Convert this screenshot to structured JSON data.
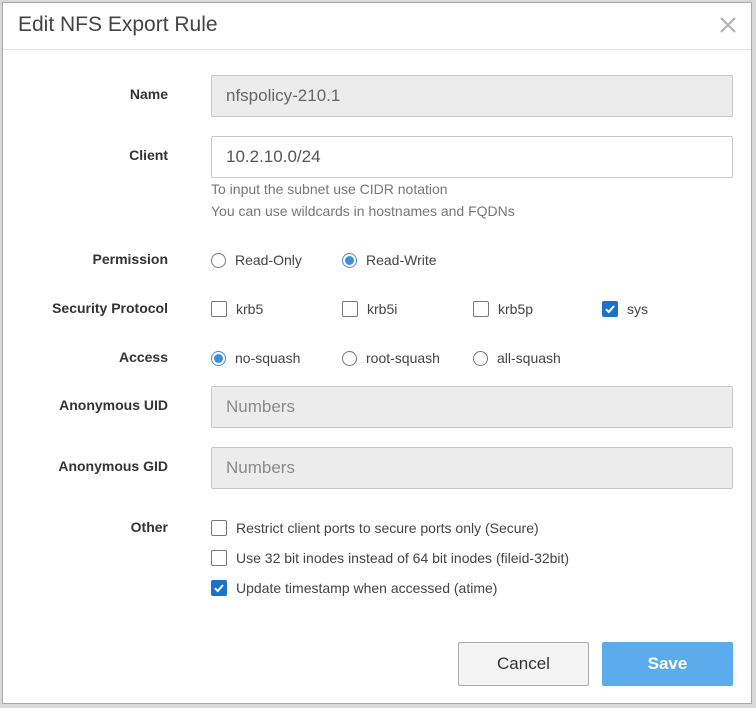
{
  "dialog": {
    "title": "Edit NFS Export Rule",
    "close_icon": "close-icon"
  },
  "fields": {
    "name": {
      "label": "Name",
      "value": "nfspolicy-210.1"
    },
    "client": {
      "label": "Client",
      "value": "10.2.10.0/24",
      "hint1": "To input the subnet use CIDR notation",
      "hint2": "You can use wildcards in hostnames and FQDNs"
    },
    "anon_uid": {
      "label": "Anonymous UID",
      "placeholder": "Numbers"
    },
    "anon_gid": {
      "label": "Anonymous GID",
      "placeholder": "Numbers"
    }
  },
  "permission": {
    "label": "Permission",
    "options": [
      {
        "label": "Read-Only",
        "checked": false
      },
      {
        "label": "Read-Write",
        "checked": true
      }
    ]
  },
  "security": {
    "label": "Security Protocol",
    "options": [
      {
        "label": "krb5",
        "checked": false
      },
      {
        "label": "krb5i",
        "checked": false
      },
      {
        "label": "krb5p",
        "checked": false
      },
      {
        "label": "sys",
        "checked": true
      }
    ]
  },
  "access": {
    "label": "Access",
    "options": [
      {
        "label": "no-squash",
        "checked": true
      },
      {
        "label": "root-squash",
        "checked": false
      },
      {
        "label": "all-squash",
        "checked": false
      }
    ]
  },
  "other": {
    "label": "Other",
    "options": [
      {
        "label": "Restrict client ports to secure ports only (Secure)",
        "checked": false
      },
      {
        "label": "Use 32 bit inodes instead of 64 bit inodes (fileid-32bit)",
        "checked": false
      },
      {
        "label": "Update timestamp when accessed (atime)",
        "checked": true
      }
    ]
  },
  "buttons": {
    "cancel": "Cancel",
    "save": "Save"
  },
  "colors": {
    "accent": "#3f8ed8",
    "checkbox_checked": "#1a73c8",
    "save_button": "#5aacec"
  }
}
